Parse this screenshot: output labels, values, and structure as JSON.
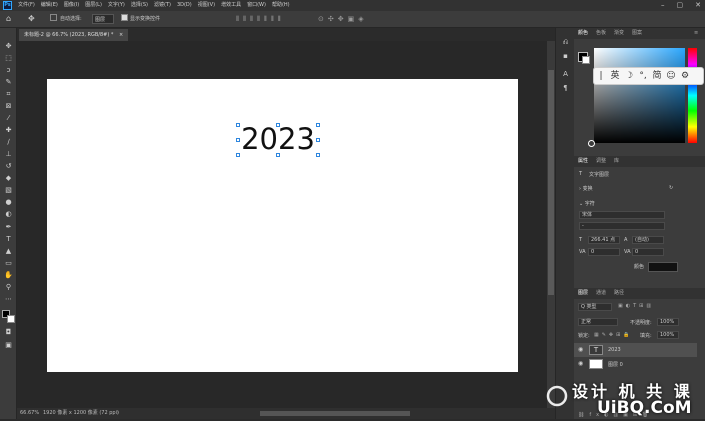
{
  "app": {
    "logo": "Ps"
  },
  "menu": [
    "文件(F)",
    "编辑(E)",
    "图像(I)",
    "图层(L)",
    "文字(Y)",
    "选择(S)",
    "滤镜(T)",
    "3D(D)",
    "视图(V)",
    "增效工具",
    "窗口(W)",
    "帮助(H)"
  ],
  "window_controls": [
    "–",
    "▢",
    "✕"
  ],
  "options_bar": {
    "auto_select_label": "自动选择:",
    "auto_select_value": "图层",
    "show_transform_label": "显示变换控件"
  },
  "document": {
    "tab_title": "未标题-2 @ 66.7% (2023, RGB/8#) *",
    "close": "×",
    "canvas_text": "2023"
  },
  "status": {
    "zoom": "66.67%",
    "info": "1920 像素 x 1200 像素 (72 ppi)",
    "arrow": "›"
  },
  "panels": {
    "color_tabs": [
      "颜色",
      "色板",
      "渐变",
      "图案"
    ],
    "properties_tabs": [
      "属性",
      "调整",
      "库"
    ],
    "layer_kind": "文字图层",
    "transform_label": "变换",
    "character_label": "字符",
    "font_family": "宋体",
    "font_style": "-",
    "font_size": "266.41 点",
    "leading": "(自动)",
    "tracking": "0",
    "kerning": "0",
    "color_label": "颜色",
    "layers_tabs": [
      "图层",
      "通道",
      "路径"
    ],
    "layer_filter": "Q 类型",
    "blend_mode": "正常",
    "opacity_label": "不透明度:",
    "opacity_value": "100%",
    "lock_label": "锁定:",
    "fill_label": "填充:",
    "fill_value": "100%",
    "layers": [
      {
        "name": "2023",
        "type": "text",
        "thumb": "T"
      },
      {
        "name": "图层 0",
        "type": "pixel",
        "thumb": ""
      }
    ]
  },
  "ime_toolbar": [
    "|",
    "英",
    "☽",
    "°,",
    "简",
    "☺",
    "⚙"
  ],
  "watermark": {
    "text": "设计 机 共 课",
    "brand": "UiBQ.CoM"
  }
}
